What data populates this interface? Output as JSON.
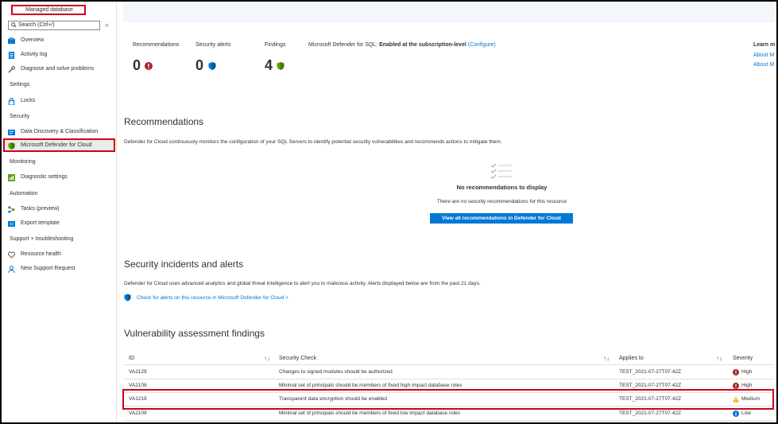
{
  "sidebar": {
    "resource_type": "Managed database",
    "search_placeholder": "Search (Ctrl+/)",
    "collapse_glyph": "«",
    "items": [
      {
        "label": "Overview"
      },
      {
        "label": "Activity log"
      },
      {
        "label": "Diagnose and solve problems"
      }
    ],
    "sections": [
      {
        "title": "Settings",
        "items": [
          {
            "label": "Locks"
          }
        ]
      },
      {
        "title": "Security",
        "items": [
          {
            "label": "Data Discovery & Classification"
          },
          {
            "label": "Microsoft Defender for Cloud"
          }
        ]
      },
      {
        "title": "Monitoring",
        "items": [
          {
            "label": "Diagnostic settings"
          }
        ]
      },
      {
        "title": "Automation",
        "items": [
          {
            "label": "Tasks (preview)"
          },
          {
            "label": "Export template"
          }
        ]
      },
      {
        "title": "Support + troubleshooting",
        "items": [
          {
            "label": "Resource health"
          },
          {
            "label": "New Support Request"
          }
        ]
      }
    ]
  },
  "summary": {
    "recommendations_label": "Recommendations",
    "recommendations_value": "0",
    "alerts_label": "Security alerts",
    "alerts_value": "0",
    "findings_label": "Findings",
    "findings_value": "4",
    "defender_prefix": "Microsoft Defender for SQL: ",
    "defender_status": "Enabled at the subscription-level",
    "defender_link": "(Configure)",
    "learn_more": "Learn m",
    "about_1": "About M",
    "about_2": "About M"
  },
  "recommendations": {
    "title": "Recommendations",
    "description": "Defender for Cloud continuously monitors the configuration of your SQL Servers to identify potential security vulnerabilities and recommends actions to mitigate them.",
    "empty_title": "No recommendations to display",
    "empty_sub": "There are no security recommendations for this resource",
    "button": "View all recommendations in Defender for Cloud"
  },
  "incidents": {
    "title": "Security incidents and alerts",
    "description": "Defender for Cloud uses advanced analytics and global threat intelligence to alert you to malicious activity. Alerts displayed below are from the past 21 days.",
    "link": "Check for alerts on this resource in Microsoft Defender for Cloud >"
  },
  "findings": {
    "title": "Vulnerability assessment findings",
    "columns": {
      "id": "ID",
      "check": "Security Check",
      "applies": "Applies to",
      "severity": "Severity"
    },
    "sort_glyph": "↑↓",
    "rows": [
      {
        "id": "VA2129",
        "check": "Changes to signed modules should be authorized",
        "applies": "TEST_2021-07-27T07-42Z",
        "severity": "High"
      },
      {
        "id": "VA2108",
        "check": "Minimal set of principals should be members of fixed high impact database roles",
        "applies": "TEST_2021-07-27T07-42Z",
        "severity": "High"
      },
      {
        "id": "VA1219",
        "check": "Transparent data encryption should be enabled",
        "applies": "TEST_2021-07-27T07-42Z",
        "severity": "Medium"
      },
      {
        "id": "VA2109",
        "check": "Minimal set of principals should be members of fixed low impact database roles",
        "applies": "TEST_2021-07-27T07-42Z",
        "severity": "Low"
      }
    ]
  },
  "colors": {
    "accent": "#0078d4",
    "high": "#a4262c",
    "medium": "#f7a800",
    "low": "#0078d4",
    "highlight": "#d0021b"
  }
}
